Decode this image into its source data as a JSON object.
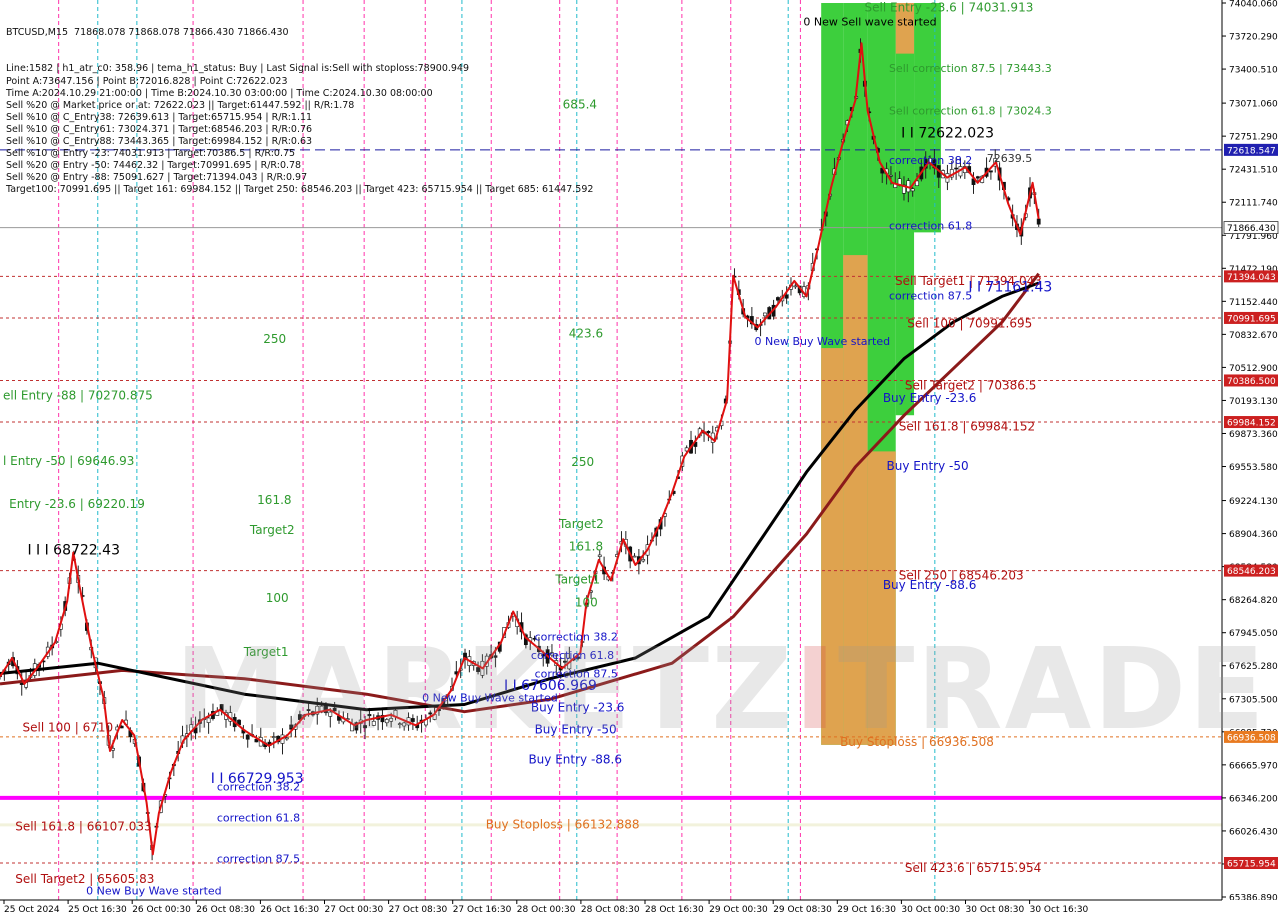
{
  "header": {
    "symbol_line": "BTCUSD,M15  71868.078 71868.078 71866.430 71866.430",
    "info_lines": [
      "Line:1582 | h1_atr_c0: 358.96 | tema_h1_status: Buy | Last Signal is:Sell with stoploss:78900.949",
      "Point A:73647.156 | Point B:72016.828 | Point C:72622.023",
      "Time A:2024.10.29 21:00:00 | Time B:2024.10.30 03:00:00 | Time C:2024.10.30 08:00:00",
      "Sell %20 @ Market price or at: 72622.023 || Target:61447.592 || R/R:1.78",
      "Sell %10 @ C_Entry38: 72639.613 | Target:65715.954 | R/R:1.11",
      "Sell %10 @ C_Entry61: 73024.371 | Target:68546.203 | R/R:0.76",
      "Sell %10 @ C_Entry88: 73443.365 | Target:69984.152 | R/R:0.63",
      "Sell %10 @ Entry -23: 74031.913 | Target:70386.5 | R/R:0.75",
      "Sell %20 @ Entry -50: 74462.32 | Target:70991.695 | R/R:0.78",
      "Sell %20 @ Entry -88: 75091.627 | Target:71394.043 | R/R:0.97",
      "Target100: 70991.695 || Target 161: 69984.152 || Target 250: 68546.203 || Target 423: 65715.954 || Target 685: 61447.592"
    ]
  },
  "watermark": {
    "part1": "MARKETZ",
    "part2": "I",
    "part3": "TRADE"
  },
  "colors": {
    "bg": "#ffffff",
    "bull": "#111111",
    "bear": "#111111",
    "ema_fast": "#e01010",
    "ma_slow": "#000000",
    "ma_mid": "#8b1a1a",
    "magenta": "#ff00ff",
    "green_zone": "#33cc33",
    "orange_zone": "#e8a050",
    "blue_text": "#1414c8",
    "red_text": "#b01010",
    "green_text": "#2e9a2e"
  },
  "chart_data": {
    "type": "candlestick",
    "symbol": "BTCUSD",
    "timeframe": "M15",
    "ylim": [
      65386.89,
      74040.06
    ],
    "y_ticks": [
      74040.06,
      73720.29,
      73400.51,
      73071.06,
      72751.29,
      72431.51,
      72111.74,
      71791.96,
      71472.19,
      71152.44,
      70832.67,
      70512.9,
      70193.13,
      69873.36,
      69553.58,
      69224.13,
      68904.36,
      68584.58,
      68264.82,
      67945.05,
      67625.28,
      67305.5,
      66985.73,
      66665.97,
      66346.2,
      66026.43,
      65706.67,
      65386.89
    ],
    "y_tick_labels": [
      "74040.060",
      "73720.290",
      "73400.510",
      "73071.060",
      "72751.290",
      "72431.510",
      "72111.740",
      "71791.960",
      "71472.190",
      "71152.440",
      "70832.670",
      "70512.900",
      "70193.130",
      "69873.360",
      "69553.580",
      "69224.130",
      "68904.360",
      "68584.580",
      "68264.820",
      "67945.050",
      "67625.280",
      "67305.500",
      "66985.730",
      "66665.970",
      "66346.200",
      "66026.430",
      "65706.670",
      "65386.890"
    ],
    "x_tick_labels": [
      "25 Oct 2024",
      "25 Oct 16:30",
      "26 Oct 00:30",
      "26 Oct 08:30",
      "26 Oct 16:30",
      "27 Oct 00:30",
      "27 Oct 08:30",
      "27 Oct 16:30",
      "28 Oct 00:30",
      "28 Oct 08:30",
      "28 Oct 16:30",
      "29 Oct 00:30",
      "29 Oct 08:30",
      "29 Oct 16:30",
      "30 Oct 00:30",
      "30 Oct 08:30",
      "30 Oct 16:30"
    ],
    "price_path": [
      [
        0,
        67520
      ],
      [
        0.01,
        67700
      ],
      [
        0.02,
        67450
      ],
      [
        0.03,
        67600
      ],
      [
        0.045,
        67850
      ],
      [
        0.055,
        68250
      ],
      [
        0.06,
        68720
      ],
      [
        0.065,
        68400
      ],
      [
        0.075,
        67800
      ],
      [
        0.085,
        67300
      ],
      [
        0.09,
        66800
      ],
      [
        0.1,
        67100
      ],
      [
        0.11,
        66950
      ],
      [
        0.12,
        66300
      ],
      [
        0.125,
        65800
      ],
      [
        0.13,
        66200
      ],
      [
        0.14,
        66600
      ],
      [
        0.15,
        66900
      ],
      [
        0.165,
        67100
      ],
      [
        0.18,
        67200
      ],
      [
        0.2,
        67000
      ],
      [
        0.22,
        66850
      ],
      [
        0.235,
        66950
      ],
      [
        0.25,
        67150
      ],
      [
        0.27,
        67200
      ],
      [
        0.29,
        67050
      ],
      [
        0.3,
        67100
      ],
      [
        0.32,
        67150
      ],
      [
        0.34,
        67050
      ],
      [
        0.355,
        67150
      ],
      [
        0.37,
        67400
      ],
      [
        0.38,
        67700
      ],
      [
        0.395,
        67600
      ],
      [
        0.41,
        67850
      ],
      [
        0.42,
        68150
      ],
      [
        0.43,
        67900
      ],
      [
        0.445,
        67750
      ],
      [
        0.46,
        67600
      ],
      [
        0.475,
        67750
      ],
      [
        0.48,
        68250
      ],
      [
        0.49,
        68650
      ],
      [
        0.5,
        68450
      ],
      [
        0.51,
        68850
      ],
      [
        0.52,
        68600
      ],
      [
        0.53,
        68750
      ],
      [
        0.54,
        69000
      ],
      [
        0.55,
        69300
      ],
      [
        0.56,
        69650
      ],
      [
        0.575,
        69900
      ],
      [
        0.585,
        69800
      ],
      [
        0.595,
        70200
      ],
      [
        0.6,
        71400
      ],
      [
        0.61,
        71000
      ],
      [
        0.62,
        70900
      ],
      [
        0.635,
        71100
      ],
      [
        0.65,
        71350
      ],
      [
        0.66,
        71200
      ],
      [
        0.67,
        71700
      ],
      [
        0.68,
        72250
      ],
      [
        0.69,
        72700
      ],
      [
        0.7,
        73100
      ],
      [
        0.705,
        73650
      ],
      [
        0.71,
        73000
      ],
      [
        0.72,
        72500
      ],
      [
        0.73,
        72300
      ],
      [
        0.745,
        72250
      ],
      [
        0.76,
        72500
      ],
      [
        0.775,
        72350
      ],
      [
        0.79,
        72450
      ],
      [
        0.8,
        72300
      ],
      [
        0.815,
        72500
      ],
      [
        0.825,
        72100
      ],
      [
        0.835,
        71800
      ],
      [
        0.845,
        72300
      ],
      [
        0.85,
        71950
      ]
    ],
    "series": [
      {
        "name": "tema fast",
        "color_key": "ema_fast"
      },
      {
        "name": "ma slow",
        "color_key": "ma_slow"
      },
      {
        "name": "ma mid",
        "color_key": "ma_mid"
      }
    ],
    "ma_slow_path": [
      [
        0,
        67550
      ],
      [
        0.08,
        67650
      ],
      [
        0.12,
        67550
      ],
      [
        0.2,
        67350
      ],
      [
        0.3,
        67200
      ],
      [
        0.38,
        67250
      ],
      [
        0.45,
        67500
      ],
      [
        0.52,
        67700
      ],
      [
        0.58,
        68100
      ],
      [
        0.62,
        68800
      ],
      [
        0.66,
        69500
      ],
      [
        0.7,
        70100
      ],
      [
        0.74,
        70600
      ],
      [
        0.78,
        70950
      ],
      [
        0.82,
        71200
      ],
      [
        0.85,
        71330
      ]
    ],
    "ma_mid_path": [
      [
        0,
        67450
      ],
      [
        0.1,
        67580
      ],
      [
        0.2,
        67500
      ],
      [
        0.3,
        67350
      ],
      [
        0.38,
        67180
      ],
      [
        0.45,
        67300
      ],
      [
        0.55,
        67650
      ],
      [
        0.6,
        68100
      ],
      [
        0.66,
        68900
      ],
      [
        0.7,
        69550
      ],
      [
        0.74,
        70050
      ],
      [
        0.78,
        70500
      ],
      [
        0.82,
        70950
      ],
      [
        0.85,
        71420
      ]
    ],
    "h_lines": [
      {
        "price": 72618.547,
        "label": "72618.547",
        "style": "dash",
        "color": "#1a1aa0",
        "badge": "#2020b0"
      },
      {
        "price": 71866.43,
        "label": "71866.430",
        "style": "solid",
        "color": "#999999",
        "badge": "#ffffff"
      },
      {
        "price": 71394.043,
        "label": "71394.043",
        "style": "dot",
        "color": "#c03030",
        "badge": "#cc2020"
      },
      {
        "price": 70991.695,
        "label": "70991.695",
        "style": "dot",
        "color": "#c03030",
        "badge": "#cc2020"
      },
      {
        "price": 70386.5,
        "label": "70386.500",
        "style": "dot",
        "color": "#c03030",
        "badge": "#cc2020"
      },
      {
        "price": 69984.152,
        "label": "69984.152",
        "style": "dot",
        "color": "#c03030",
        "badge": "#cc2020"
      },
      {
        "price": 68546.203,
        "label": "68546.203",
        "style": "dot",
        "color": "#c03030",
        "badge": "#cc2020"
      },
      {
        "price": 66936.508,
        "label": "66936.508",
        "style": "dot",
        "color": "#e07020",
        "badge": "#e87a20"
      },
      {
        "price": 65715.954,
        "label": "65715.954",
        "style": "dot",
        "color": "#c03030",
        "badge": "#cc2020"
      }
    ],
    "annotations": [
      {
        "text": "Sell Entry -23.6 | 74031.913",
        "fx": 0.705,
        "price": 73960,
        "color": "#2e9a2e",
        "size": 12
      },
      {
        "text": "0 New Sell wave started",
        "fx": 0.655,
        "price": 73820,
        "color": "#000000",
        "size": 11
      },
      {
        "text": "Sell correction 87.5 | 73443.3",
        "fx": 0.725,
        "price": 73370,
        "color": "#2e9a2e",
        "size": 11
      },
      {
        "text": "Sell correction 61.8 | 73024.3",
        "fx": 0.725,
        "price": 72960,
        "color": "#2e9a2e",
        "size": 11
      },
      {
        "text": "I I 72622.023",
        "fx": 0.735,
        "price": 72740,
        "color": "#000000",
        "size": 14
      },
      {
        "text": "correction 38.2",
        "fx": 0.725,
        "price": 72480,
        "color": "#1414c8",
        "size": 11
      },
      {
        "text": "72639.5",
        "fx": 0.805,
        "price": 72500,
        "color": "#333333",
        "size": 11
      },
      {
        "text": "correction 61.8",
        "fx": 0.725,
        "price": 71850,
        "color": "#1414c8",
        "size": 11
      },
      {
        "text": "Sell Target1 | 71394.043",
        "fx": 0.73,
        "price": 71310,
        "color": "#b01010",
        "size": 12
      },
      {
        "text": "I I 71161.43",
        "fx": 0.79,
        "price": 71250,
        "color": "#1414c8",
        "size": 14
      },
      {
        "text": "correction 87.5",
        "fx": 0.725,
        "price": 71170,
        "color": "#1414c8",
        "size": 11
      },
      {
        "text": "Sell 100 | 70991.695",
        "fx": 0.74,
        "price": 70900,
        "color": "#b01010",
        "size": 12
      },
      {
        "text": "0 New Buy Wave started",
        "fx": 0.615,
        "price": 70730,
        "color": "#1414c8",
        "size": 11
      },
      {
        "text": "Sell Target2 | 70386.5",
        "fx": 0.738,
        "price": 70300,
        "color": "#b01010",
        "size": 12
      },
      {
        "text": "Buy Entry -23.6",
        "fx": 0.72,
        "price": 70180,
        "color": "#1414c8",
        "size": 12
      },
      {
        "text": "Sell 161.8 | 69984.152",
        "fx": 0.733,
        "price": 69900,
        "color": "#b01010",
        "size": 12
      },
      {
        "text": "Buy Entry -50",
        "fx": 0.723,
        "price": 69520,
        "color": "#1414c8",
        "size": 12
      },
      {
        "text": "Sell 250 | 68546.203",
        "fx": 0.733,
        "price": 68460,
        "color": "#b01010",
        "size": 12
      },
      {
        "text": "Buy Entry -88.6",
        "fx": 0.72,
        "price": 68370,
        "color": "#1414c8",
        "size": 12
      },
      {
        "text": "Buy Stoploss | 66936.508",
        "fx": 0.685,
        "price": 66850,
        "color": "#e07020",
        "size": 12
      },
      {
        "text": "Sell  423.6 | 65715.954",
        "fx": 0.738,
        "price": 65630,
        "color": "#b01010",
        "size": 12
      },
      {
        "text": "685.4",
        "fx": 0.458,
        "price": 73020,
        "color": "#2e9a2e",
        "size": 12
      },
      {
        "text": "423.6",
        "fx": 0.463,
        "price": 70800,
        "color": "#2e9a2e",
        "size": 12
      },
      {
        "text": "250",
        "fx": 0.465,
        "price": 69560,
        "color": "#2e9a2e",
        "size": 12
      },
      {
        "text": "Target2",
        "fx": 0.455,
        "price": 68960,
        "color": "#2e9a2e",
        "size": 12
      },
      {
        "text": "161.8",
        "fx": 0.463,
        "price": 68740,
        "color": "#2e9a2e",
        "size": 12
      },
      {
        "text": "Target1",
        "fx": 0.452,
        "price": 68420,
        "color": "#2e9a2e",
        "size": 12
      },
      {
        "text": "100",
        "fx": 0.468,
        "price": 68200,
        "color": "#2e9a2e",
        "size": 12
      },
      {
        "text": "correction 38.2",
        "fx": 0.435,
        "price": 67870,
        "color": "#1414c8",
        "size": 11
      },
      {
        "text": "correction 61.8",
        "fx": 0.432,
        "price": 67690,
        "color": "#1414c8",
        "size": 11
      },
      {
        "text": "correction 87.5",
        "fx": 0.435,
        "price": 67510,
        "color": "#1414c8",
        "size": 11
      },
      {
        "text": "I I 67606.969",
        "fx": 0.41,
        "price": 67390,
        "color": "#1414c8",
        "size": 14
      },
      {
        "text": "0 New Buy Wave started",
        "fx": 0.343,
        "price": 67280,
        "color": "#1414c8",
        "size": 11
      },
      {
        "text": "Buy Entry -23.6",
        "fx": 0.432,
        "price": 67180,
        "color": "#1414c8",
        "size": 12
      },
      {
        "text": "Buy Entry -50",
        "fx": 0.435,
        "price": 66970,
        "color": "#1414c8",
        "size": 12
      },
      {
        "text": "Buy Entry -88.6",
        "fx": 0.43,
        "price": 66680,
        "color": "#1414c8",
        "size": 12
      },
      {
        "text": "Buy Stoploss | 66132.888",
        "fx": 0.395,
        "price": 66050,
        "color": "#e07020",
        "size": 12
      },
      {
        "text": "ell Entry -88 | 70270.875",
        "fx": 0.0,
        "price": 70200,
        "color": "#2e9a2e",
        "size": 12
      },
      {
        "text": "l Entry -50 | 69646.93",
        "fx": 0.0,
        "price": 69570,
        "color": "#2e9a2e",
        "size": 12
      },
      {
        "text": "Entry -23.6 | 69220.19",
        "fx": 0.005,
        "price": 69150,
        "color": "#2e9a2e",
        "size": 12
      },
      {
        "text": "I I I 68722.43",
        "fx": 0.02,
        "price": 68700,
        "color": "#000000",
        "size": 14
      },
      {
        "text": "250",
        "fx": 0.213,
        "price": 70750,
        "color": "#2e9a2e",
        "size": 12
      },
      {
        "text": "161.8",
        "fx": 0.208,
        "price": 69190,
        "color": "#2e9a2e",
        "size": 12
      },
      {
        "text": "Target2",
        "fx": 0.202,
        "price": 68900,
        "color": "#2e9a2e",
        "size": 12
      },
      {
        "text": "100",
        "fx": 0.215,
        "price": 68240,
        "color": "#2e9a2e",
        "size": 12
      },
      {
        "text": "Target1",
        "fx": 0.197,
        "price": 67720,
        "color": "#2e9a2e",
        "size": 12
      },
      {
        "text": "Sell 100 | 6710",
        "fx": 0.016,
        "price": 66990,
        "color": "#b01010",
        "size": 12
      },
      {
        "text": "I I 66729.953",
        "fx": 0.17,
        "price": 66490,
        "color": "#1414c8",
        "size": 14
      },
      {
        "text": "correction 38.2",
        "fx": 0.175,
        "price": 66420,
        "color": "#1414c8",
        "size": 11
      },
      {
        "text": "correction 61.8",
        "fx": 0.175,
        "price": 66120,
        "color": "#1414c8",
        "size": 11
      },
      {
        "text": "correction 87.5",
        "fx": 0.175,
        "price": 65720,
        "color": "#1414c8",
        "size": 11
      },
      {
        "text": "Sell 161.8 | 66107.033",
        "fx": 0.01,
        "price": 66030,
        "color": "#b01010",
        "size": 12
      },
      {
        "text": "Sell Target2 | 65605.83",
        "fx": 0.01,
        "price": 65520,
        "color": "#b01010",
        "size": 12
      },
      {
        "text": "0 New Buy Wave started",
        "fx": 0.068,
        "price": 65410,
        "color": "#1414c8",
        "size": 11
      }
    ],
    "zones": [
      {
        "fx1": 0.672,
        "fx2": 0.69,
        "p1": 74040,
        "p2": 66860,
        "color": "#33cc33"
      },
      {
        "fx1": 0.69,
        "fx2": 0.71,
        "p1": 74040,
        "p2": 66860,
        "color": "#33cc33"
      },
      {
        "fx1": 0.672,
        "fx2": 0.69,
        "p1": 70700,
        "p2": 66860,
        "color": "#e8a050"
      },
      {
        "fx1": 0.69,
        "fx2": 0.71,
        "p1": 71600,
        "p2": 66860,
        "color": "#e8a050"
      },
      {
        "fx1": 0.71,
        "fx2": 0.733,
        "p1": 74040,
        "p2": 66860,
        "color": "#33cc33"
      },
      {
        "fx1": 0.71,
        "fx2": 0.733,
        "p1": 69700,
        "p2": 66860,
        "color": "#e8a050"
      },
      {
        "fx1": 0.733,
        "fx2": 0.748,
        "p1": 74040,
        "p2": 70050,
        "color": "#33cc33"
      },
      {
        "fx1": 0.748,
        "fx2": 0.77,
        "p1": 74040,
        "p2": 71820,
        "color": "#33cc33"
      },
      {
        "fx1": 0.733,
        "fx2": 0.748,
        "p1": 74040,
        "p2": 73550,
        "color": "#e8a050"
      }
    ],
    "v_lines_magenta": [
      0.048,
      0.158,
      0.248,
      0.298,
      0.348,
      0.402,
      0.458,
      0.505,
      0.558,
      0.598,
      0.655
    ],
    "v_lines_cyan": [
      0.08,
      0.112,
      0.378,
      0.472,
      0.645,
      0.765
    ]
  }
}
